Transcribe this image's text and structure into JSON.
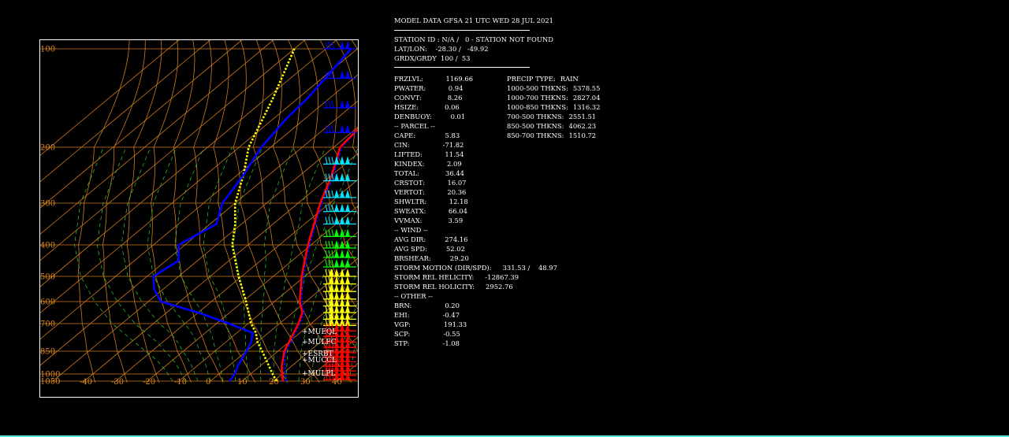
{
  "header": {
    "title": "MODEL DATA GFSA 21 UTC WED 28 JUL 2021",
    "station": "STATION ID : N/A /   0 - STATION NOT FOUND",
    "latlon": "LAT/LON:    -28.30 /   -49.92",
    "grid": "GRDX/GRDY  100 /  53"
  },
  "left_col": [
    {
      "k": "FRZLVL:",
      "v": "1169.66"
    },
    {
      "k": "PWATER:",
      "v": "0.94"
    },
    {
      "k": "CONVT:",
      "v": "8.26"
    },
    {
      "k": "HSIZE:",
      "v": "0.06"
    },
    {
      "k": "DENBUOY:",
      "v": "0.01"
    },
    {
      "k": "-- PARCEL --",
      "v": ""
    },
    {
      "k": "CAPE:",
      "v": "5.83"
    },
    {
      "k": "CIN:",
      "v": "-71.82"
    },
    {
      "k": "LIFTED:",
      "v": "11.54"
    },
    {
      "k": "KINDEX:",
      "v": "2.09"
    },
    {
      "k": "TOTAL:",
      "v": "36.44"
    },
    {
      "k": "CRSTOT:",
      "v": "16.07"
    },
    {
      "k": "VERTOT:",
      "v": "20.36"
    },
    {
      "k": "SHWLTR:",
      "v": "12.18"
    },
    {
      "k": "SWEATX:",
      "v": "66.04"
    },
    {
      "k": "VVMAX:",
      "v": "3.59"
    },
    {
      "k": "-- WIND --",
      "v": ""
    },
    {
      "k": "AVG DIR:",
      "v": "274.16"
    },
    {
      "k": "AVG SPD:",
      "v": "52.02"
    },
    {
      "k": "BRSHEAR:",
      "v": "29.20"
    },
    {
      "k": "STORM MOTION (DIR/SPD):",
      "v": "331.53 /    48.97"
    },
    {
      "k": "STORM REL HELICITY:",
      "v": "-12867.39"
    },
    {
      "k": "STORM REL HOLICITY:",
      "v": "2952.76"
    },
    {
      "k": "-- OTHER --",
      "v": ""
    },
    {
      "k": "BRN:",
      "v": "0.20"
    },
    {
      "k": "EHI:",
      "v": "-0.47"
    },
    {
      "k": "VGP:",
      "v": "191.33"
    },
    {
      "k": "SCP:",
      "v": "-0.55"
    },
    {
      "k": "STP:",
      "v": "-1.08"
    }
  ],
  "right_col": [
    {
      "k": "PRECIP TYPE:",
      "v": "RAIN"
    },
    {
      "k": "1000-500 THKNS:",
      "v": "5378.55"
    },
    {
      "k": "1000-700 THKNS:",
      "v": "2827.04"
    },
    {
      "k": "1000-850 THKNS:",
      "v": "1316.32"
    },
    {
      "k": "700-500 THKNS:",
      "v": "2551.51"
    },
    {
      "k": "850-500 THKNS:",
      "v": "4062.23"
    },
    {
      "k": "850-700 THKNS:",
      "v": "1510.72"
    }
  ],
  "chart_data": {
    "type": "line",
    "pressure_labels": [
      "100",
      "200",
      "300",
      "400",
      "500",
      "600",
      "700",
      "850",
      "1000",
      "1050"
    ],
    "pressure_levels": [
      100,
      200,
      300,
      400,
      500,
      600,
      700,
      850,
      1000,
      1050
    ],
    "temperature_labels": [
      "-40",
      "-30",
      "-20",
      "-10",
      "0",
      "10",
      "20",
      "30",
      "40"
    ],
    "temperature_ticks": [
      -40,
      -30,
      -20,
      -10,
      0,
      10,
      20,
      30,
      40
    ],
    "level_labels": [
      "MUEQL",
      "MULFC",
      "ESRBT",
      "MUCCL",
      "MULPL"
    ],
    "colors": {
      "border": "#ffffff",
      "isobar": "#d07a1a",
      "isotherm": "#d07a1a",
      "dry_adiabat": "#d07a1a",
      "moist_adiabat": "#33cc33",
      "temperature": "#ff0000",
      "dewpoint": "#0000ff",
      "parcel": "#ffff00",
      "virtual_temp": "#0000ff",
      "wind_blue": "#0000ff",
      "wind_cyan": "#00e5ff",
      "wind_green": "#00ff00",
      "wind_yellow": "#ffff00",
      "wind_red": "#ff0000"
    },
    "series": [
      {
        "name": "temperature",
        "points": [
          [
            1050,
            23
          ],
          [
            1000,
            20
          ],
          [
            950,
            17
          ],
          [
            900,
            14.5
          ],
          [
            850,
            12
          ],
          [
            800,
            10
          ],
          [
            750,
            8
          ],
          [
            700,
            6
          ],
          [
            650,
            3
          ],
          [
            600,
            -2
          ],
          [
            550,
            -6.5
          ],
          [
            500,
            -11
          ],
          [
            450,
            -16
          ],
          [
            400,
            -21
          ],
          [
            350,
            -27
          ],
          [
            300,
            -33
          ],
          [
            250,
            -40
          ],
          [
            200,
            -48
          ],
          [
            170,
            -50
          ],
          [
            150,
            -51
          ],
          [
            120,
            -54
          ],
          [
            100,
            -57
          ]
        ]
      },
      {
        "name": "dewpoint",
        "points": [
          [
            1050,
            6
          ],
          [
            1000,
            5
          ],
          [
            950,
            3
          ],
          [
            900,
            1.5
          ],
          [
            850,
            0
          ],
          [
            800,
            -2
          ],
          [
            750,
            -5
          ],
          [
            700,
            -16
          ],
          [
            650,
            -30
          ],
          [
            600,
            -46
          ],
          [
            550,
            -53
          ],
          [
            500,
            -58
          ],
          [
            450,
            -56
          ],
          [
            400,
            -62
          ],
          [
            350,
            -58
          ],
          [
            300,
            -64
          ],
          [
            250,
            -68
          ],
          [
            200,
            -73
          ],
          [
            170,
            -76
          ],
          [
            150,
            -77
          ],
          [
            120,
            -80
          ],
          [
            100,
            -82
          ]
        ]
      },
      {
        "name": "parcel",
        "points": [
          [
            1050,
            21
          ],
          [
            1000,
            17
          ],
          [
            950,
            13
          ],
          [
            900,
            9
          ],
          [
            850,
            5
          ],
          [
            800,
            0
          ],
          [
            750,
            -4
          ],
          [
            700,
            -9
          ],
          [
            650,
            -14
          ],
          [
            600,
            -19
          ],
          [
            550,
            -25
          ],
          [
            500,
            -31
          ],
          [
            450,
            -38
          ],
          [
            400,
            -45
          ],
          [
            350,
            -52
          ],
          [
            300,
            -60
          ],
          [
            250,
            -68
          ],
          [
            200,
            -77
          ],
          [
            150,
            -88
          ],
          [
            100,
            -100
          ]
        ]
      },
      {
        "name": "virtual_temp",
        "points": [
          [
            1050,
            24
          ],
          [
            1000,
            21
          ],
          [
            950,
            18
          ],
          [
            900,
            15
          ],
          [
            850,
            12.5
          ],
          [
            800,
            10.5
          ],
          [
            750,
            8.5
          ],
          [
            700,
            6.5
          ],
          [
            650,
            3.5
          ],
          [
            600,
            -1.5
          ],
          [
            550,
            -6
          ],
          [
            500,
            -10.5
          ],
          [
            450,
            -15.5
          ],
          [
            400,
            -20.5
          ],
          [
            350,
            -26.5
          ],
          [
            300,
            -32.5
          ],
          [
            250,
            -39.5
          ],
          [
            200,
            -47.5
          ],
          [
            170,
            -50
          ],
          [
            150,
            -51
          ],
          [
            120,
            -54.5
          ],
          [
            100,
            -57.5
          ]
        ]
      }
    ]
  }
}
